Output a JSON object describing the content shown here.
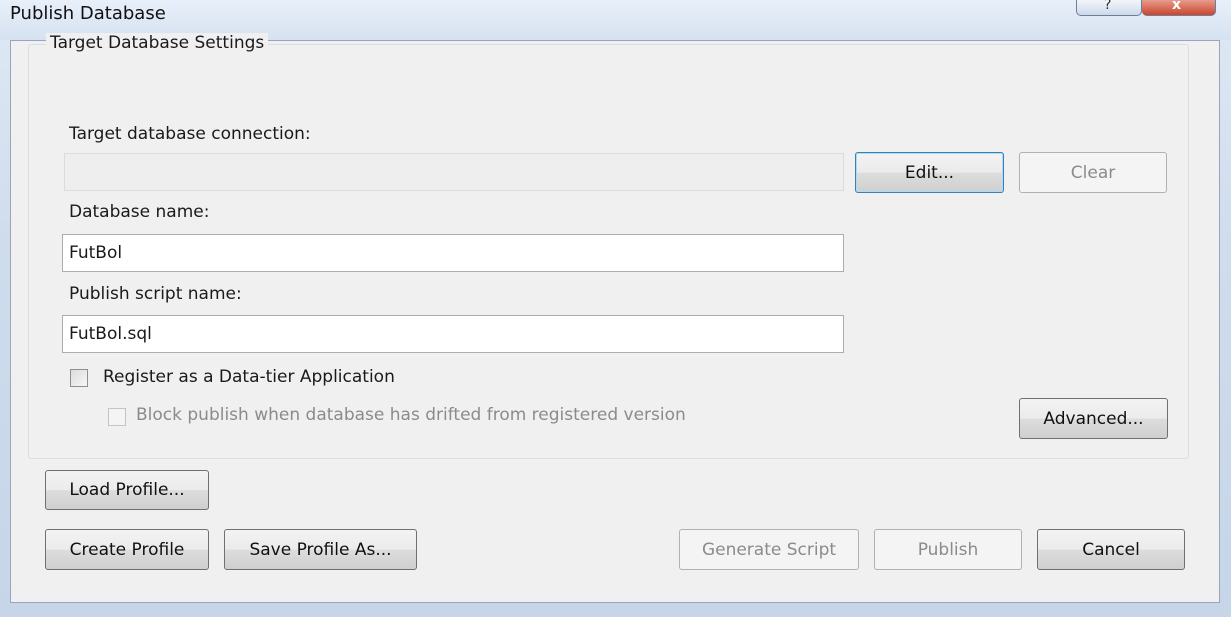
{
  "window": {
    "title": "Publish Database"
  },
  "titlebar": {
    "help_glyph": "?",
    "close_glyph": "x"
  },
  "target_settings": {
    "group_title": "Target Database Settings",
    "connection_label": "Target database connection:",
    "connection_value": "",
    "edit_label": "Edit...",
    "clear_label": "Clear",
    "database_name_label": "Database name:",
    "database_name_value": "FutBol",
    "script_name_label": "Publish script name:",
    "script_name_value": "FutBol.sql",
    "register_label": "Register as a Data-tier Application",
    "register_checked": false,
    "block_label": "Block publish when database has drifted from registered version",
    "block_checked": false,
    "advanced_label": "Advanced..."
  },
  "footer": {
    "load_profile_label": "Load Profile...",
    "create_profile_label": "Create Profile",
    "save_profile_label": "Save Profile As...",
    "generate_script_label": "Generate Script",
    "publish_label": "Publish",
    "cancel_label": "Cancel"
  }
}
